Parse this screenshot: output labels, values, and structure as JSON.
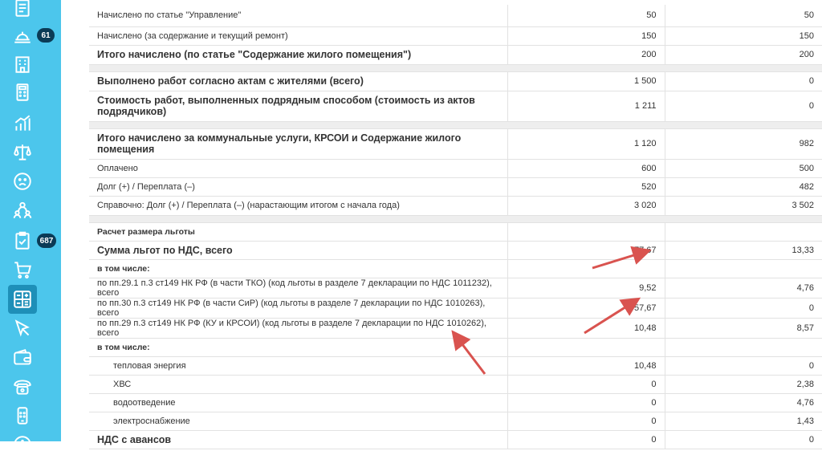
{
  "sidebar": {
    "items": [
      {
        "icon": "document-list-icon"
      },
      {
        "icon": "service-bell-icon",
        "badge": "61"
      },
      {
        "icon": "building-icon"
      },
      {
        "icon": "calculator-icon"
      },
      {
        "icon": "bar-chart-icon"
      },
      {
        "icon": "scales-icon"
      },
      {
        "icon": "sad-face-icon"
      },
      {
        "icon": "people-group-icon"
      },
      {
        "icon": "clipboard-check-icon",
        "badge": "687"
      },
      {
        "icon": "shopping-cart-icon"
      },
      {
        "icon": "grid-calculator-icon",
        "active": true
      },
      {
        "icon": "cursor-pointer-icon"
      },
      {
        "icon": "wallet-icon"
      },
      {
        "icon": "phone-icon"
      },
      {
        "icon": "mobile-phone-icon"
      },
      {
        "icon": "info-icon"
      }
    ]
  },
  "report": {
    "rows": [
      {
        "type": "normal",
        "label": "Начислено по статье \"Управление\"",
        "v1": "50",
        "v2": "50"
      },
      {
        "type": "normal",
        "label": "Начислено (за содержание и текущий ремонт)",
        "v1": "150",
        "v2": "150"
      },
      {
        "type": "bold",
        "label": "Итого начислено (по статье \"Содержание жилого помещения\")",
        "v1": "200",
        "v2": "200"
      },
      {
        "type": "sep"
      },
      {
        "type": "bold",
        "label": "Выполнено работ согласно актам с жителями (всего)",
        "v1": "1 500",
        "v2": "0"
      },
      {
        "type": "bold",
        "label": "Стоимость работ, выполненных подрядным способом (стоимость из актов подрядчиков)",
        "v1": "1 211",
        "v2": "0"
      },
      {
        "type": "sep"
      },
      {
        "type": "bold",
        "label": "Итого начислено за коммунальные услуги, КРСОИ и Содержание жилого помещения",
        "v1": "1 120",
        "v2": "982"
      },
      {
        "type": "normal",
        "label": "Оплачено",
        "v1": "600",
        "v2": "500"
      },
      {
        "type": "normal",
        "label": "Долг (+) / Переплата (–)",
        "v1": "520",
        "v2": "482"
      },
      {
        "type": "normal",
        "label": "Справочно: Долг (+) / Переплата (–) (нарастающим итогом с начала года)",
        "v1": "3 020",
        "v2": "3 502"
      },
      {
        "type": "sep"
      },
      {
        "type": "sub",
        "label": "Расчет размера льготы",
        "v1": "",
        "v2": ""
      },
      {
        "type": "bold",
        "label": "Сумма льгот по НДС, всего",
        "v1": "77,67",
        "v2": "13,33"
      },
      {
        "type": "sub",
        "label": "в том числе:",
        "v1": "",
        "v2": ""
      },
      {
        "type": "normal",
        "label": "по пп.29.1 п.3 ст149 НК РФ (в части ТКО) (код льготы в разделе 7 декларации по НДС 1011232), всего",
        "v1": "9,52",
        "v2": "4,76"
      },
      {
        "type": "normal",
        "label": "по пп.30 п.3 ст149 НК РФ (в части СиР) (код льготы в разделе 7 декларации по НДС 1010263), всего",
        "v1": "57,67",
        "v2": "0"
      },
      {
        "type": "normal",
        "label": "по пп.29 п.3 ст149 НК РФ (КУ и КРСОИ) (код льготы в разделе 7 декларации по НДС 1010262), всего",
        "v1": "10,48",
        "v2": "8,57"
      },
      {
        "type": "sub",
        "label": "в том числе:",
        "v1": "",
        "v2": ""
      },
      {
        "type": "indent",
        "label": "тепловая энергия",
        "v1": "10,48",
        "v2": "0"
      },
      {
        "type": "indent",
        "label": "ХВС",
        "v1": "0",
        "v2": "2,38"
      },
      {
        "type": "indent",
        "label": "водоотведение",
        "v1": "0",
        "v2": "4,76"
      },
      {
        "type": "indent",
        "label": "электроснабжение",
        "v1": "0",
        "v2": "1,43"
      },
      {
        "type": "bold",
        "label": "НДС с авансов",
        "v1": "0",
        "v2": "0"
      }
    ]
  },
  "colors": {
    "sidebar": "#4cc6ec",
    "sidebar_active": "#1e8fb8",
    "badge": "#0b3b56",
    "arrow": "#d9534f",
    "separator": "#eeeeee"
  }
}
